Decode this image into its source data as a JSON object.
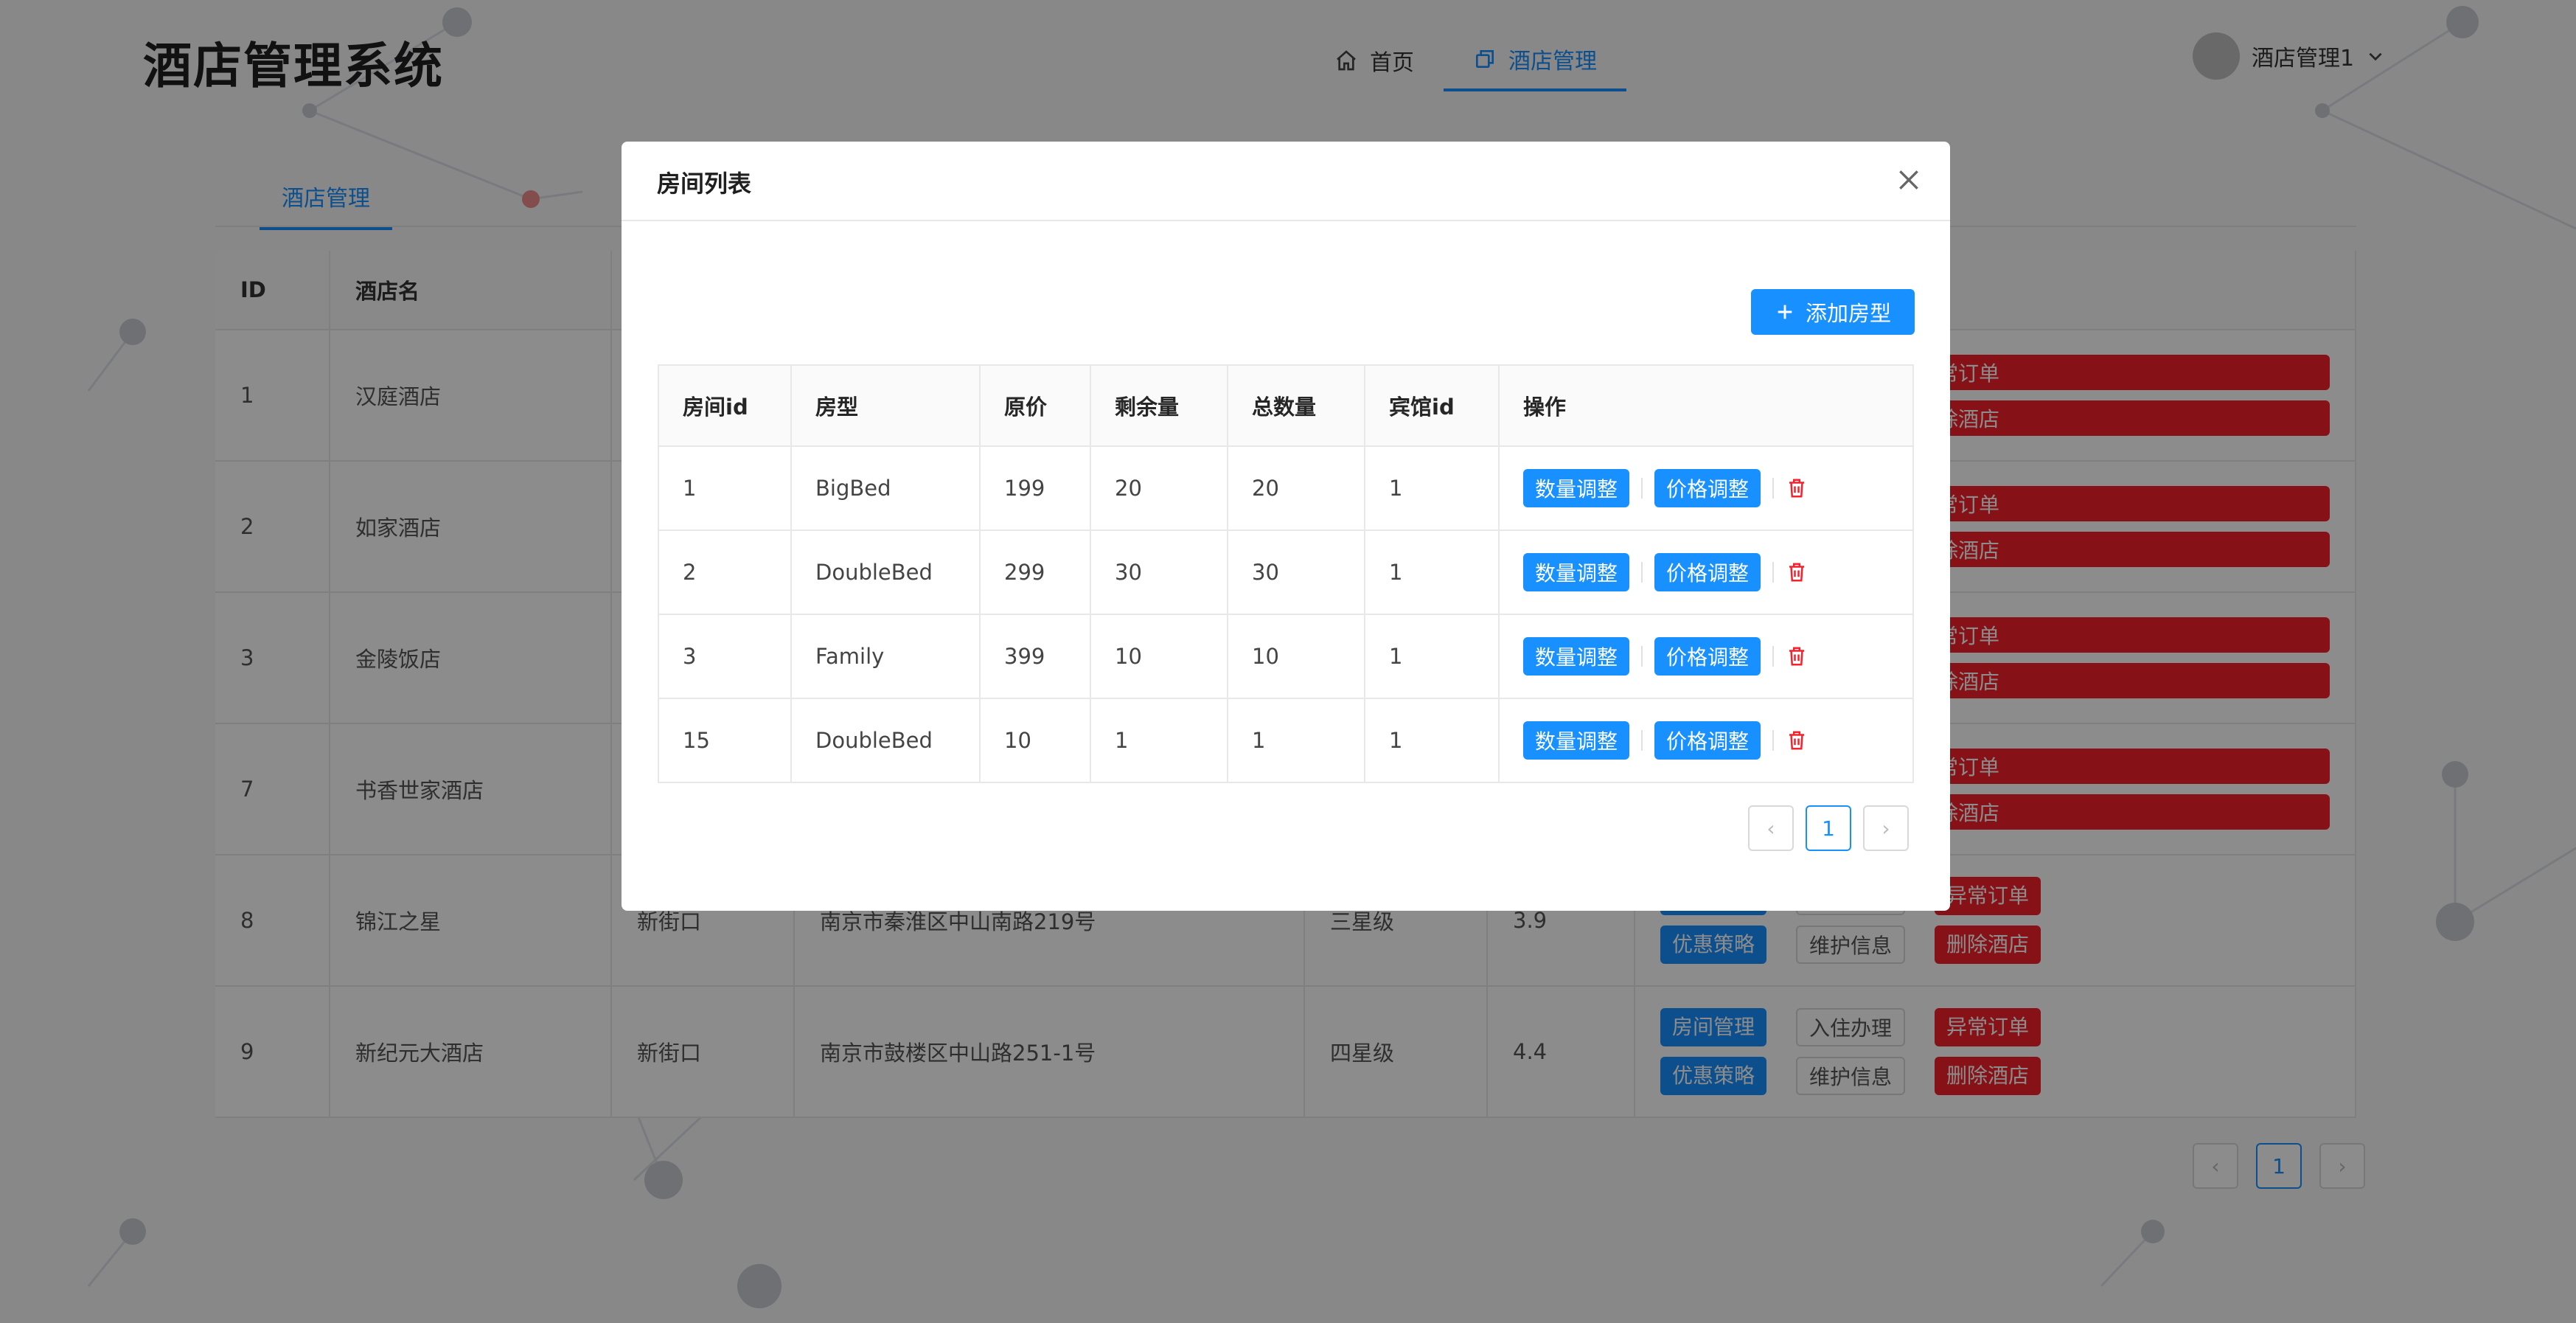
{
  "app": {
    "title": "酒店管理系统"
  },
  "nav": [
    {
      "label": "首页",
      "icon": "home-icon"
    },
    {
      "label": "酒店管理",
      "icon": "copy-icon",
      "active": true
    }
  ],
  "user": {
    "name": "酒店管理1"
  },
  "page_tab": {
    "label": "酒店管理"
  },
  "bg_table": {
    "headers": [
      "ID",
      "酒店名",
      "",
      "",
      "",
      "",
      ""
    ],
    "rows": [
      {
        "id": "1",
        "name": "汉庭酒店",
        "area": "",
        "address": "",
        "star": "",
        "score": ""
      },
      {
        "id": "2",
        "name": "如家酒店",
        "area": "",
        "address": "",
        "star": "",
        "score": ""
      },
      {
        "id": "3",
        "name": "金陵饭店",
        "area": "",
        "address": "",
        "star": "",
        "score": ""
      },
      {
        "id": "7",
        "name": "书香世家酒店",
        "area": "",
        "address": "",
        "star": "",
        "score": ""
      },
      {
        "id": "8",
        "name": "锦江之星",
        "area": "新街口",
        "address": "南京市秦淮区中山南路219号",
        "star": "三星级",
        "score": "3.9"
      },
      {
        "id": "9",
        "name": "新纪元大酒店",
        "area": "新街口",
        "address": "南京市鼓楼区中山路251-1号",
        "star": "四星级",
        "score": "4.4"
      }
    ],
    "actions": {
      "room_mgmt": "房间管理",
      "checkin": "入住办理",
      "abnormal_orders": "异常订单",
      "promo": "优惠策略",
      "maintain": "维护信息",
      "delete_hotel": "删除酒店"
    },
    "partial_actions": {
      "abnormal_orders": "常订单",
      "delete_hotel": "除酒店"
    }
  },
  "bg_pager": {
    "current": "1"
  },
  "modal": {
    "title": "房间列表",
    "add_button": "添加房型",
    "headers": [
      "房间id",
      "房型",
      "原价",
      "剩余量",
      "总数量",
      "宾馆id",
      "操作"
    ],
    "rows": [
      {
        "room_id": "1",
        "type": "BigBed",
        "price": "199",
        "remaining": "20",
        "total": "20",
        "hotel_id": "1"
      },
      {
        "room_id": "2",
        "type": "DoubleBed",
        "price": "299",
        "remaining": "30",
        "total": "30",
        "hotel_id": "1"
      },
      {
        "room_id": "3",
        "type": "Family",
        "price": "399",
        "remaining": "10",
        "total": "10",
        "hotel_id": "1"
      },
      {
        "room_id": "15",
        "type": "DoubleBed",
        "price": "10",
        "remaining": "1",
        "total": "1",
        "hotel_id": "1"
      }
    ],
    "row_actions": {
      "qty": "数量调整",
      "price": "价格调整"
    },
    "pager": {
      "current": "1"
    }
  },
  "colors": {
    "primary": "#1890ff",
    "danger": "#f5222d",
    "mask": "rgba(0,0,0,0.45)"
  }
}
